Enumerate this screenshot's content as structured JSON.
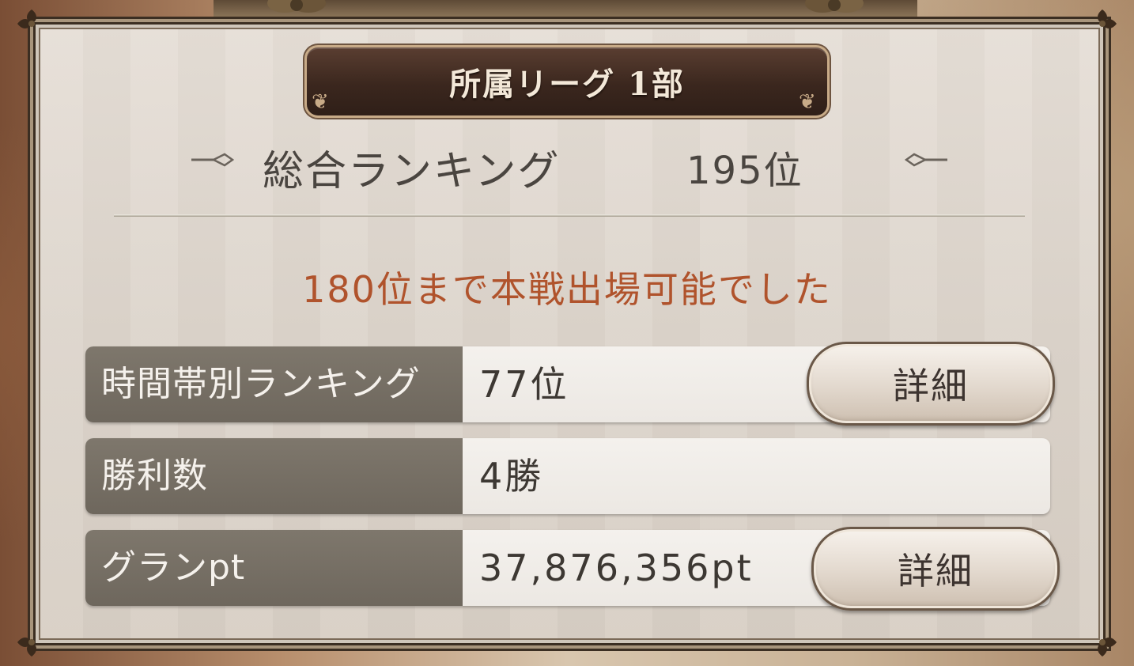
{
  "header": {
    "league_title": "所属リーグ 1部"
  },
  "overall": {
    "label": "総合ランキング",
    "value": "195位"
  },
  "notice": "180位まで本戦出場可能でした",
  "stats": [
    {
      "label": "時間帯別ランキング",
      "value": "77位",
      "button": "詳細"
    },
    {
      "label": "勝利数",
      "value": "4勝"
    },
    {
      "label": "グランpt",
      "value": "37,876,356pt",
      "button": "詳細"
    }
  ],
  "colors": {
    "notice_text": "#b0532c",
    "label_bg": "#746d63",
    "header_plate": "#3b271e"
  }
}
